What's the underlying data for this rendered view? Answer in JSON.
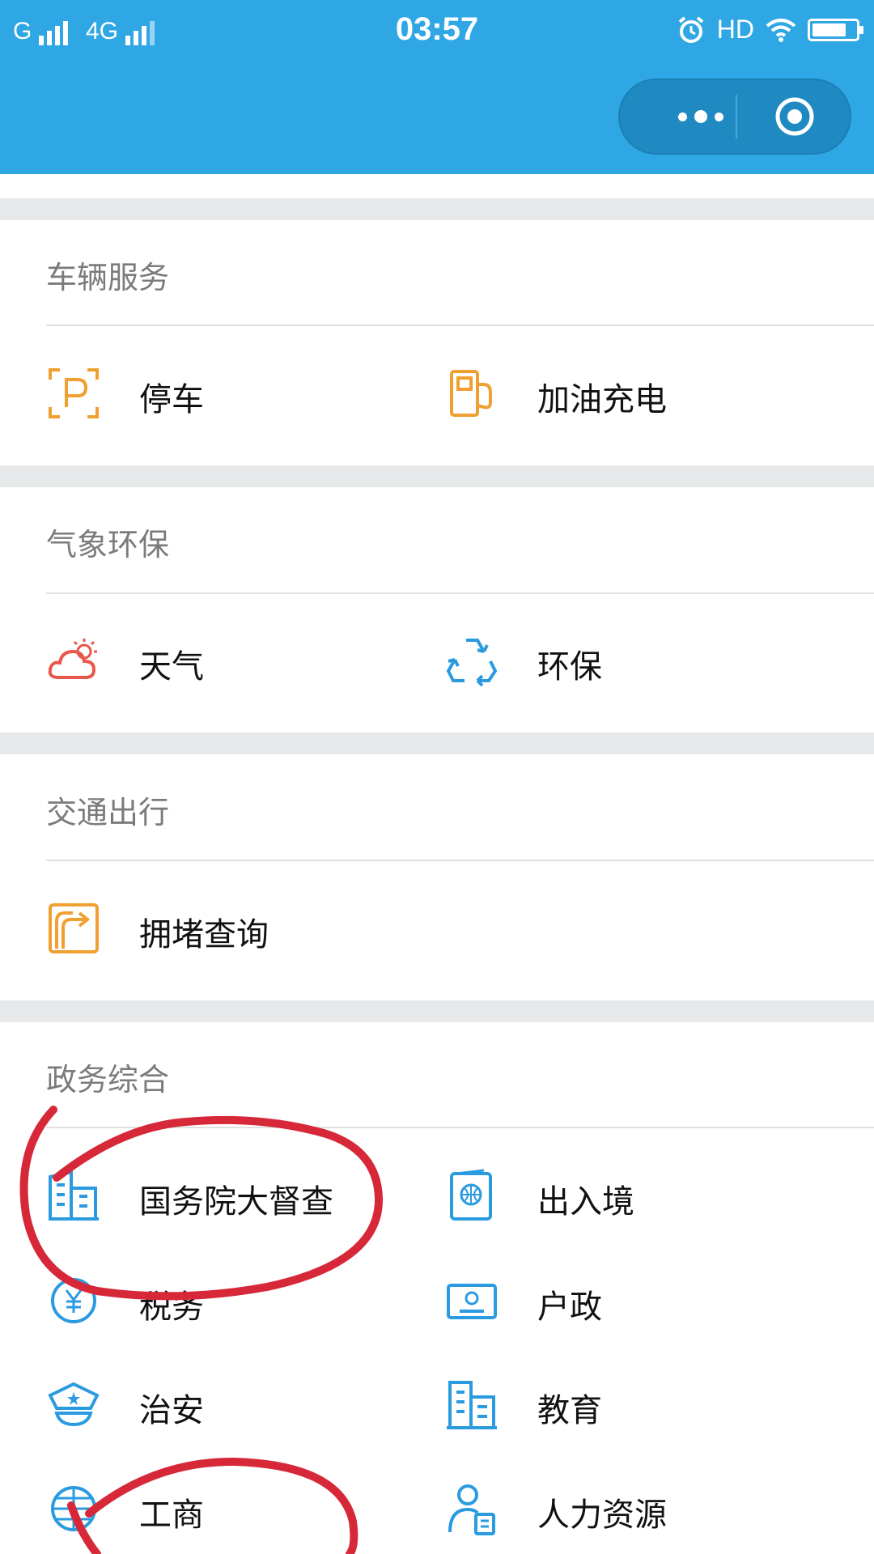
{
  "status_bar": {
    "carrier_1": "G",
    "carrier_2": "4G",
    "time": "03:57",
    "hd": "HD",
    "icons": [
      "signal-icon",
      "alarm-icon",
      "wifi-icon",
      "battery-charging-icon"
    ]
  },
  "capsule": {
    "more_icon": "more-dots-icon",
    "close_icon": "target-circle-icon"
  },
  "sections": [
    {
      "title": "车辆服务",
      "items": [
        {
          "label": "停车",
          "icon": "parking-icon",
          "color": "#f0a030"
        },
        {
          "label": "加油充电",
          "icon": "fuel-pump-icon",
          "color": "#f0a030"
        }
      ]
    },
    {
      "title": "气象环保",
      "items": [
        {
          "label": "天气",
          "icon": "weather-cloud-sun-icon",
          "color": "#e8574a"
        },
        {
          "label": "环保",
          "icon": "recycle-icon",
          "color": "#2b9be0"
        }
      ]
    },
    {
      "title": "交通出行",
      "items": [
        {
          "label": "拥堵查询",
          "icon": "route-sign-icon",
          "color": "#f0a030"
        }
      ]
    },
    {
      "title": "政务综合",
      "items": [
        {
          "label": "国务院大督查",
          "icon": "government-building-icon",
          "color": "#2b9be0"
        },
        {
          "label": "出入境",
          "icon": "passport-icon",
          "color": "#2b9be0"
        },
        {
          "label": "税务",
          "icon": "tax-coin-icon",
          "color": "#2b9be0"
        },
        {
          "label": "户政",
          "icon": "id-card-icon",
          "color": "#2b9be0"
        },
        {
          "label": "治安",
          "icon": "police-cap-icon",
          "color": "#2b9be0"
        },
        {
          "label": "教育",
          "icon": "school-building-icon",
          "color": "#2b9be0"
        },
        {
          "label": "工商",
          "icon": "commerce-globe-icon",
          "color": "#2b9be0"
        },
        {
          "label": "人力资源",
          "icon": "person-badge-icon",
          "color": "#2b9be0"
        }
      ]
    }
  ],
  "colors": {
    "header": "#2fa7e4",
    "annotation_ink": "#d62839",
    "orange": "#f0a030",
    "blue": "#2b9be0"
  }
}
